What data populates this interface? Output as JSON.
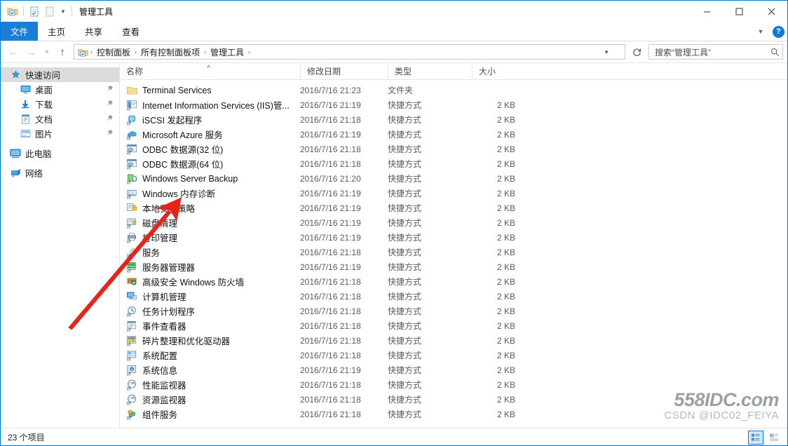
{
  "window": {
    "title": "管理工具",
    "quick_access": [
      {
        "name": "folder-icon",
        "label": "管理工具"
      },
      {
        "name": "properties-icon",
        "label": "属性"
      },
      {
        "name": "new-folder-icon",
        "label": "新建文件夹"
      }
    ],
    "controls": {
      "minimize": "—",
      "maximize": "□",
      "close": "✕",
      "collapse_ribbon": "ˇ",
      "help": "?"
    }
  },
  "ribbon": {
    "tabs": [
      {
        "label": "文件",
        "selected": true
      },
      {
        "label": "主页",
        "selected": false
      },
      {
        "label": "共享",
        "selected": false
      },
      {
        "label": "查看",
        "selected": false
      }
    ],
    "accent_color": "#1a7fd4"
  },
  "navigation": {
    "back": "←",
    "forward": "→",
    "recent": "ˇ",
    "up": "↑",
    "refresh": "↻",
    "breadcrumbs": [
      "控制面板",
      "所有控制面板项",
      "管理工具"
    ],
    "separator": "›",
    "dropdown_caret": "ˇ"
  },
  "search": {
    "placeholder": "搜索“管理工具”",
    "icon": "search-icon"
  },
  "sidebar": {
    "items": [
      {
        "label": "快速访问",
        "icon": "star-pin-icon",
        "selected": true,
        "pinned": false,
        "indent": 0
      },
      {
        "label": "桌面",
        "icon": "desktop-icon",
        "selected": false,
        "pinned": true,
        "indent": 1
      },
      {
        "label": "下载",
        "icon": "download-icon",
        "selected": false,
        "pinned": true,
        "indent": 1
      },
      {
        "label": "文档",
        "icon": "documents-icon",
        "selected": false,
        "pinned": true,
        "indent": 1
      },
      {
        "label": "图片",
        "icon": "pictures-icon",
        "selected": false,
        "pinned": true,
        "indent": 1
      },
      {
        "label": "此电脑",
        "icon": "this-pc-icon",
        "selected": false,
        "pinned": false,
        "indent": 0
      },
      {
        "label": "网络",
        "icon": "network-icon",
        "selected": false,
        "pinned": false,
        "indent": 0
      }
    ],
    "pin_glyph": "📌"
  },
  "filelist": {
    "columns": [
      {
        "label": "名称",
        "sorted": "asc",
        "sort_glyph": "˄"
      },
      {
        "label": "修改日期",
        "sorted": null
      },
      {
        "label": "类型",
        "sorted": null
      },
      {
        "label": "大小",
        "sorted": null
      }
    ],
    "rows": [
      {
        "name": "Terminal Services",
        "date": "2016/7/16 21:23",
        "type": "文件夹",
        "size": "",
        "icon": "folder-icon"
      },
      {
        "name": "Internet Information Services (IIS)管...",
        "date": "2016/7/16 21:19",
        "type": "快捷方式",
        "size": "2 KB",
        "icon": "iis-icon"
      },
      {
        "name": "iSCSI 发起程序",
        "date": "2016/7/16 21:18",
        "type": "快捷方式",
        "size": "2 KB",
        "icon": "iscsi-icon"
      },
      {
        "name": "Microsoft Azure 服务",
        "date": "2016/7/16 21:19",
        "type": "快捷方式",
        "size": "2 KB",
        "icon": "azure-icon"
      },
      {
        "name": "ODBC 数据源(32 位)",
        "date": "2016/7/16 21:18",
        "type": "快捷方式",
        "size": "2 KB",
        "icon": "odbc-icon"
      },
      {
        "name": "ODBC 数据源(64 位)",
        "date": "2016/7/16 21:18",
        "type": "快捷方式",
        "size": "2 KB",
        "icon": "odbc-icon"
      },
      {
        "name": "Windows Server Backup",
        "date": "2016/7/16 21:20",
        "type": "快捷方式",
        "size": "2 KB",
        "icon": "backup-icon"
      },
      {
        "name": "Windows 内存诊断",
        "date": "2016/7/16 21:19",
        "type": "快捷方式",
        "size": "2 KB",
        "icon": "memory-icon"
      },
      {
        "name": "本地安全策略",
        "date": "2016/7/16 21:19",
        "type": "快捷方式",
        "size": "2 KB",
        "icon": "security-policy-icon"
      },
      {
        "name": "磁盘清理",
        "date": "2016/7/16 21:19",
        "type": "快捷方式",
        "size": "2 KB",
        "icon": "disk-cleanup-icon"
      },
      {
        "name": "打印管理",
        "date": "2016/7/16 21:19",
        "type": "快捷方式",
        "size": "2 KB",
        "icon": "print-management-icon"
      },
      {
        "name": "服务",
        "date": "2016/7/16 21:18",
        "type": "快捷方式",
        "size": "2 KB",
        "icon": "services-icon"
      },
      {
        "name": "服务器管理器",
        "date": "2016/7/16 21:19",
        "type": "快捷方式",
        "size": "2 KB",
        "icon": "server-manager-icon"
      },
      {
        "name": "高级安全 Windows 防火墙",
        "date": "2016/7/16 21:18",
        "type": "快捷方式",
        "size": "2 KB",
        "icon": "firewall-icon"
      },
      {
        "name": "计算机管理",
        "date": "2016/7/16 21:18",
        "type": "快捷方式",
        "size": "2 KB",
        "icon": "computer-management-icon"
      },
      {
        "name": "任务计划程序",
        "date": "2016/7/16 21:18",
        "type": "快捷方式",
        "size": "2 KB",
        "icon": "task-scheduler-icon"
      },
      {
        "name": "事件查看器",
        "date": "2016/7/16 21:18",
        "type": "快捷方式",
        "size": "2 KB",
        "icon": "event-viewer-icon"
      },
      {
        "name": "碎片整理和优化驱动器",
        "date": "2016/7/16 21:18",
        "type": "快捷方式",
        "size": "2 KB",
        "icon": "defrag-icon"
      },
      {
        "name": "系统配置",
        "date": "2016/7/16 21:18",
        "type": "快捷方式",
        "size": "2 KB",
        "icon": "msconfig-icon"
      },
      {
        "name": "系统信息",
        "date": "2016/7/16 21:19",
        "type": "快捷方式",
        "size": "2 KB",
        "icon": "sysinfo-icon"
      },
      {
        "name": "性能监视器",
        "date": "2016/7/16 21:18",
        "type": "快捷方式",
        "size": "2 KB",
        "icon": "perfmon-icon"
      },
      {
        "name": "资源监视器",
        "date": "2016/7/16 21:18",
        "type": "快捷方式",
        "size": "2 KB",
        "icon": "resmon-icon"
      },
      {
        "name": "组件服务",
        "date": "2016/7/16 21:18",
        "type": "快捷方式",
        "size": "2 KB",
        "icon": "component-services-icon"
      }
    ]
  },
  "status": {
    "item_count": "23 个项目",
    "view_details_icon": "details-view-icon",
    "view_large_icon": "large-icons-view-icon"
  },
  "annotation": {
    "arrow_color": "#e8231a",
    "points_at": "本地安全策略"
  },
  "watermark": {
    "main": "558IDC.com",
    "sub": "CSDN @IDC02_FEIYA"
  }
}
